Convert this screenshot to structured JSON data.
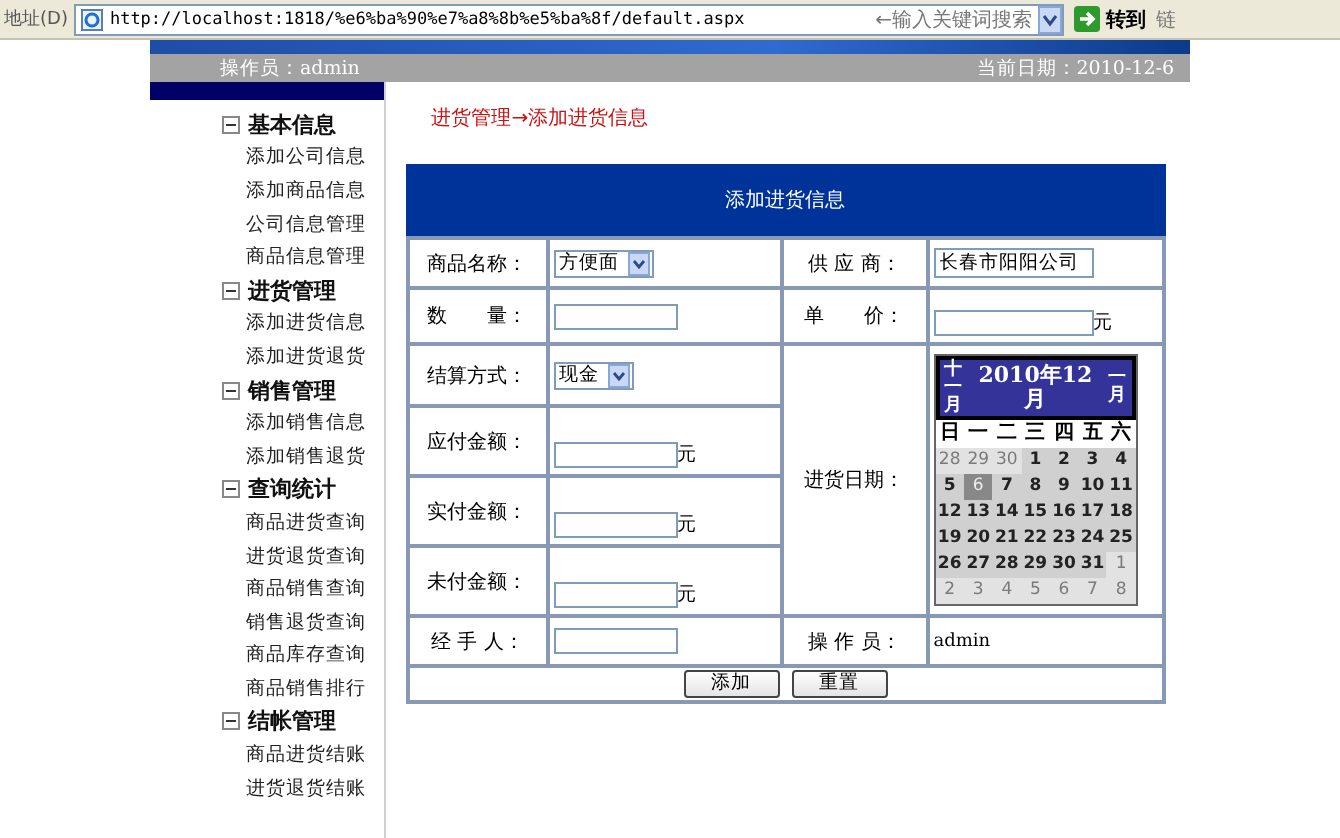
{
  "address_bar": {
    "label": "地址(D)",
    "url": "http://localhost:1818/%e6%ba%90%e7%a8%8b%e5%ba%8f/default.aspx",
    "search": {
      "placeholder": "←输入关键词搜索"
    },
    "go_button": "转到",
    "links_label": "链"
  },
  "top_bar": {
    "operator": "操作员：admin",
    "date": "当前日期：2010-12-6"
  },
  "sidebar": {
    "sections": [
      {
        "title": "基本信息",
        "expanded": true,
        "items": [
          "添加公司信息",
          "添加商品信息",
          "公司信息管理",
          "商品信息管理"
        ]
      },
      {
        "title": "进货管理",
        "expanded": true,
        "items": [
          "添加进货信息",
          "添加进货退货"
        ]
      },
      {
        "title": "销售管理",
        "expanded": true,
        "items": [
          "添加销售信息",
          "添加销售退货"
        ]
      },
      {
        "title": "查询统计",
        "expanded": true,
        "items": [
          "商品进货查询",
          "进货退货查询",
          "商品销售查询",
          "销售退货查询",
          "商品库存查询",
          "商品销售排行"
        ]
      },
      {
        "title": "结帐管理",
        "expanded": true,
        "items": [
          "商品进货结账",
          "进货退货结账"
        ]
      }
    ]
  },
  "breadcrumb": "进货管理→添加进货信息",
  "form": {
    "title": "添加进货信息",
    "product": {
      "label": "商品名称：",
      "value": "方便面"
    },
    "supplier": {
      "label": "供 应 商：",
      "value": "长春市阳阳公司"
    },
    "quantity": {
      "label": "数　　量："
    },
    "unit_price": {
      "label": "单　　价：",
      "unit": "元"
    },
    "payment_method": {
      "label": "结算方式：",
      "value": "现金"
    },
    "amount_due": {
      "label": "应付金额：",
      "unit": "元"
    },
    "amount_paid": {
      "label": "实付金额：",
      "unit": "元"
    },
    "amount_unpaid": {
      "label": "未付金额：",
      "unit": "元"
    },
    "purchase_date": {
      "label": "进货日期："
    },
    "handler": {
      "label": "经 手 人："
    },
    "operator": {
      "label": "操 作 员：",
      "value": "admin"
    },
    "buttons": [
      "添加",
      "重置"
    ]
  },
  "calendar": {
    "prev": "十一月",
    "title": "2010年12月",
    "next": "一月",
    "weekdays": [
      "日",
      "一",
      "二",
      "三",
      "四",
      "五",
      "六"
    ],
    "weeks": [
      [
        {
          "day": "28",
          "other_month": true,
          "selected": false
        },
        {
          "day": "29",
          "other_month": true,
          "selected": false
        },
        {
          "day": "30",
          "other_month": true,
          "selected": false
        },
        {
          "day": "1",
          "other_month": false,
          "selected": false
        },
        {
          "day": "2",
          "other_month": false,
          "selected": false
        },
        {
          "day": "3",
          "other_month": false,
          "selected": false
        },
        {
          "day": "4",
          "other_month": false,
          "selected": false
        }
      ],
      [
        {
          "day": "5",
          "other_month": false,
          "selected": false
        },
        {
          "day": "6",
          "other_month": false,
          "selected": true
        },
        {
          "day": "7",
          "other_month": false,
          "selected": false
        },
        {
          "day": "8",
          "other_month": false,
          "selected": false
        },
        {
          "day": "9",
          "other_month": false,
          "selected": false
        },
        {
          "day": "10",
          "other_month": false,
          "selected": false
        },
        {
          "day": "11",
          "other_month": false,
          "selected": false
        }
      ],
      [
        {
          "day": "12",
          "other_month": false,
          "selected": false
        },
        {
          "day": "13",
          "other_month": false,
          "selected": false
        },
        {
          "day": "14",
          "other_month": false,
          "selected": false
        },
        {
          "day": "15",
          "other_month": false,
          "selected": false
        },
        {
          "day": "16",
          "other_month": false,
          "selected": false
        },
        {
          "day": "17",
          "other_month": false,
          "selected": false
        },
        {
          "day": "18",
          "other_month": false,
          "selected": false
        }
      ],
      [
        {
          "day": "19",
          "other_month": false,
          "selected": false
        },
        {
          "day": "20",
          "other_month": false,
          "selected": false
        },
        {
          "day": "21",
          "other_month": false,
          "selected": false
        },
        {
          "day": "22",
          "other_month": false,
          "selected": false
        },
        {
          "day": "23",
          "other_month": false,
          "selected": false
        },
        {
          "day": "24",
          "other_month": false,
          "selected": false
        },
        {
          "day": "25",
          "other_month": false,
          "selected": false
        }
      ],
      [
        {
          "day": "26",
          "other_month": false,
          "selected": false
        },
        {
          "day": "27",
          "other_month": false,
          "selected": false
        },
        {
          "day": "28",
          "other_month": false,
          "selected": false
        },
        {
          "day": "29",
          "other_month": false,
          "selected": false
        },
        {
          "day": "30",
          "other_month": false,
          "selected": false
        },
        {
          "day": "31",
          "other_month": false,
          "selected": false
        },
        {
          "day": "1",
          "other_month": true,
          "selected": false
        }
      ],
      [
        {
          "day": "2",
          "other_month": true,
          "selected": false
        },
        {
          "day": "3",
          "other_month": true,
          "selected": false
        },
        {
          "day": "4",
          "other_month": true,
          "selected": false
        },
        {
          "day": "5",
          "other_month": true,
          "selected": false
        },
        {
          "day": "6",
          "other_month": true,
          "selected": false
        },
        {
          "day": "7",
          "other_month": true,
          "selected": false
        },
        {
          "day": "8",
          "other_month": true,
          "selected": false
        }
      ]
    ]
  }
}
